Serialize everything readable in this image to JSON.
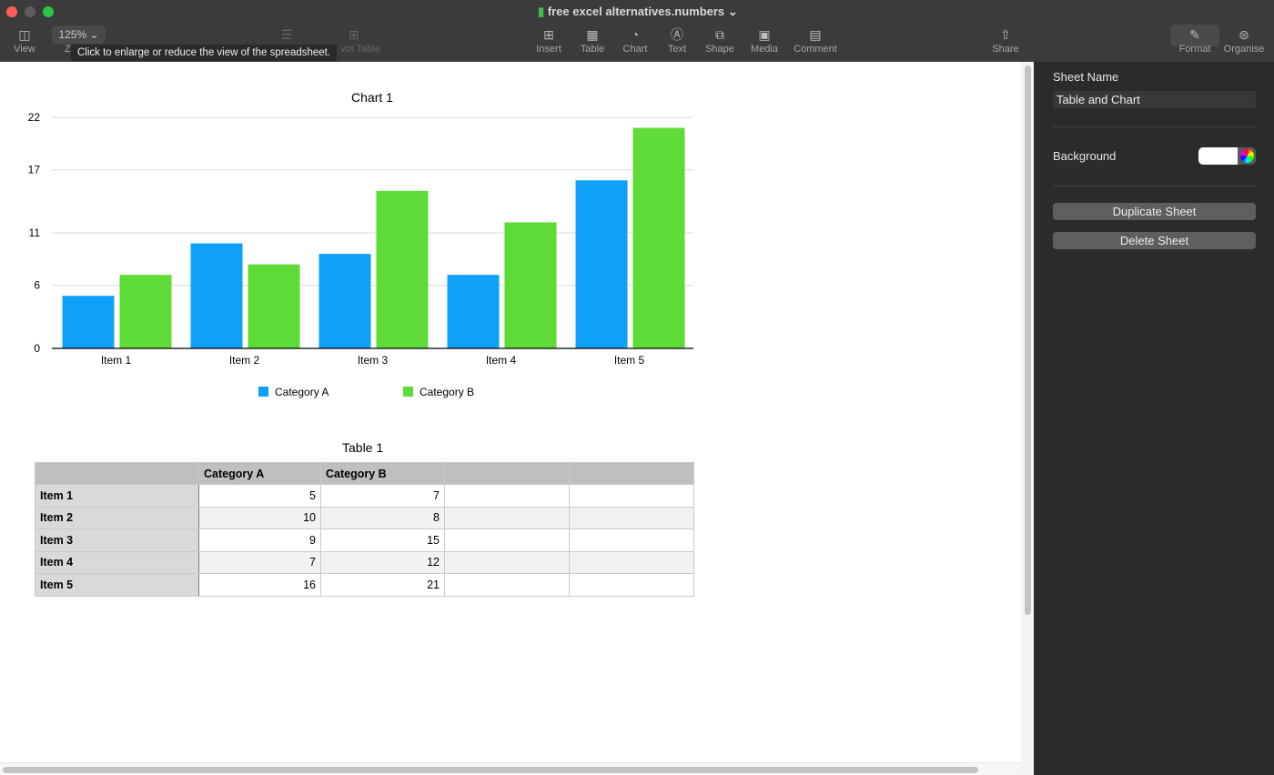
{
  "window": {
    "title": "free excel alternatives.numbers"
  },
  "toolbar": {
    "view": "View",
    "zoom_value": "125%",
    "zoom_label": "Z",
    "pivot": "vot Table",
    "tooltip": "Click to enlarge or reduce the view of the spreadsheet.",
    "items": [
      {
        "label": "Insert",
        "icon": "insert-icon"
      },
      {
        "label": "Table",
        "icon": "table-icon"
      },
      {
        "label": "Chart",
        "icon": "chart-icon"
      },
      {
        "label": "Text",
        "icon": "text-icon"
      },
      {
        "label": "Shape",
        "icon": "shape-icon"
      },
      {
        "label": "Media",
        "icon": "media-icon"
      },
      {
        "label": "Comment",
        "icon": "comment-icon"
      }
    ],
    "share": "Share",
    "format": "Format",
    "organise": "Organise"
  },
  "panel": {
    "sheet_name_label": "Sheet Name",
    "sheet_name": "Table and Chart",
    "background_label": "Background",
    "background_color": "#ffffff",
    "duplicate": "Duplicate Sheet",
    "delete": "Delete Sheet"
  },
  "chart_data": {
    "type": "bar",
    "title": "Chart 1",
    "categories": [
      "Item 1",
      "Item 2",
      "Item 3",
      "Item 4",
      "Item 5"
    ],
    "series": [
      {
        "name": "Category A",
        "values": [
          5,
          10,
          9,
          7,
          16
        ],
        "color": "#0fa0f8"
      },
      {
        "name": "Category B",
        "values": [
          7,
          8,
          15,
          12,
          21
        ],
        "color": "#5fdb38"
      }
    ],
    "yticks": [
      "0",
      "6",
      "11",
      "17",
      "22"
    ],
    "ylim": [
      0,
      22
    ],
    "grid": true,
    "legend": "bottom"
  },
  "table": {
    "title": "Table 1",
    "headers": [
      "",
      "Category A",
      "Category B",
      "",
      ""
    ],
    "rows": [
      [
        "Item 1",
        "5",
        "7"
      ],
      [
        "Item 2",
        "10",
        "8"
      ],
      [
        "Item 3",
        "9",
        "15"
      ],
      [
        "Item 4",
        "7",
        "12"
      ],
      [
        "Item 5",
        "16",
        "21"
      ]
    ]
  }
}
